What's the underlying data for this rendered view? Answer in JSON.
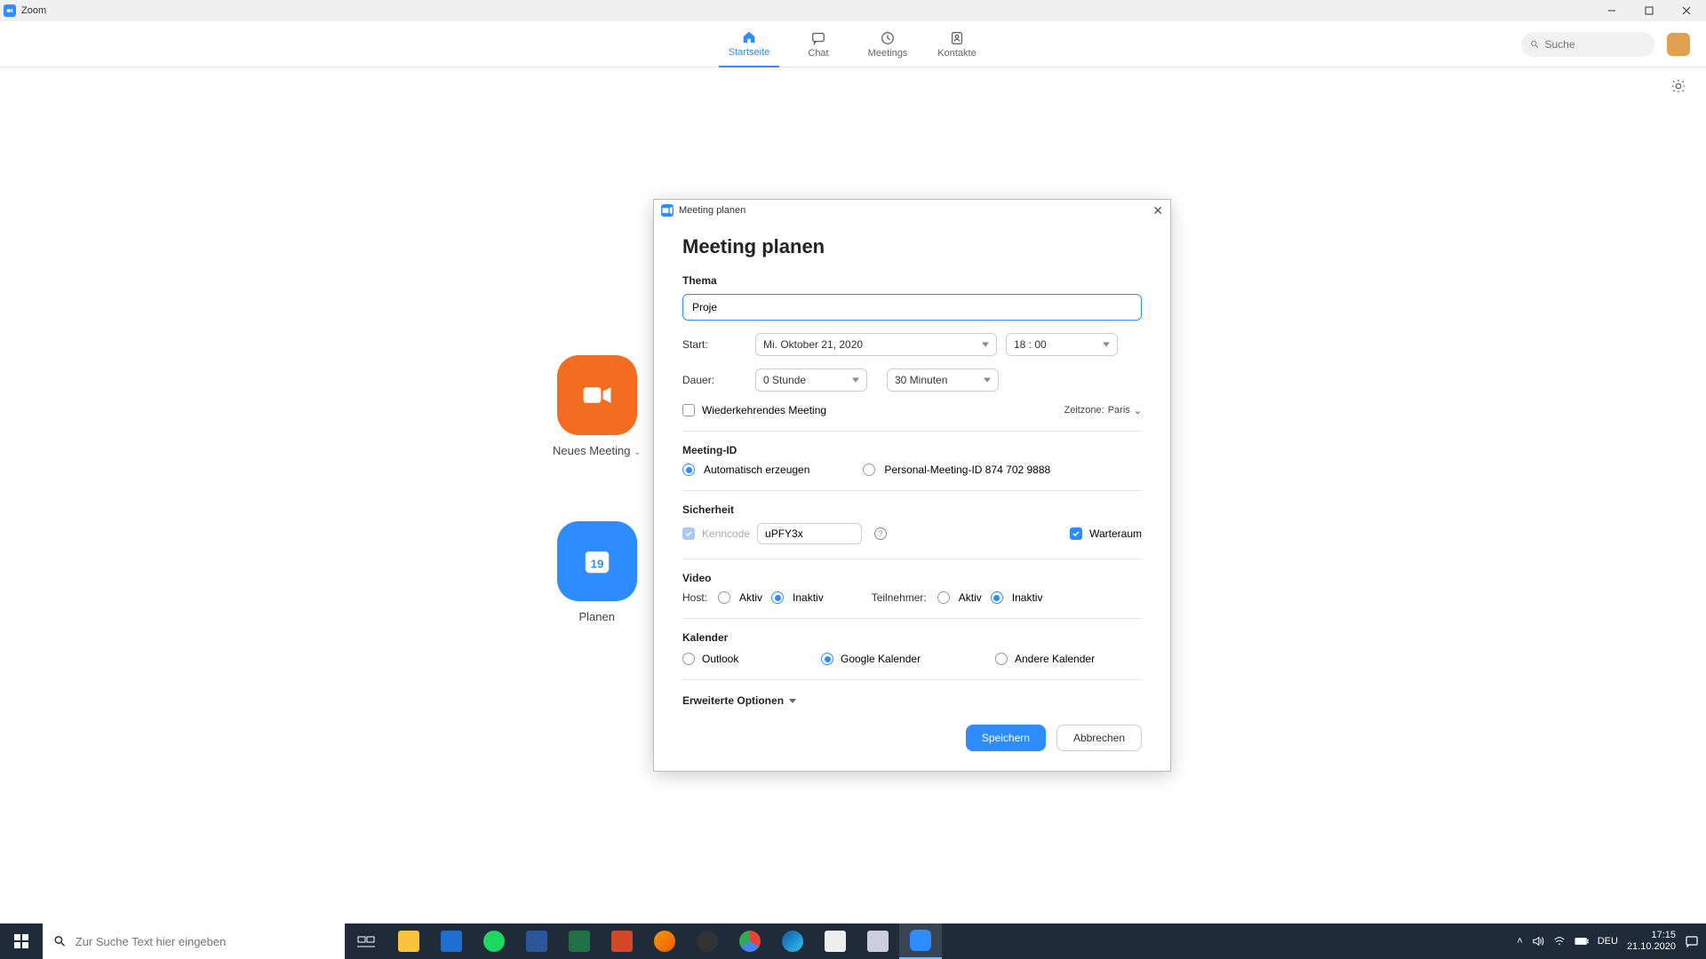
{
  "titlebar": {
    "app": "Zoom"
  },
  "nav": {
    "tabs": [
      {
        "label": "Startseite"
      },
      {
        "label": "Chat"
      },
      {
        "label": "Meetings"
      },
      {
        "label": "Kontakte"
      }
    ],
    "search_placeholder": "Suche"
  },
  "bg": {
    "new_meeting": "Neues Meeting",
    "schedule": "Planen",
    "calendar_day": "19"
  },
  "modal": {
    "window_title": "Meeting planen",
    "heading": "Meeting planen",
    "theme_label": "Thema",
    "theme_value": "Proje",
    "start_label": "Start:",
    "start_date": "Mi.  Oktober  21,  2020",
    "start_time": "18 : 00",
    "duration_label": "Dauer:",
    "duration_hours": "0 Stunde",
    "duration_minutes": "30 Minuten",
    "recurring": "Wiederkehrendes Meeting",
    "timezone_label": "Zeitzone:",
    "timezone_value": "Paris",
    "meeting_id_label": "Meeting-ID",
    "id_auto": "Automatisch erzeugen",
    "id_personal": "Personal-Meeting-ID 874 702 9888",
    "security_label": "Sicherheit",
    "passcode_label": "Kenncode",
    "passcode_value": "uPFY3x",
    "waitroom": "Warteraum",
    "video_label": "Video",
    "host_label": "Host:",
    "participant_label": "Teilnehmer:",
    "active": "Aktiv",
    "inactive": "Inaktiv",
    "calendar_label": "Kalender",
    "cal_outlook": "Outlook",
    "cal_google": "Google Kalender",
    "cal_other": "Andere Kalender",
    "advanced": "Erweiterte Optionen",
    "save": "Speichern",
    "cancel": "Abbrechen"
  },
  "taskbar": {
    "search_placeholder": "Zur Suche Text hier eingeben",
    "lang": "DEU",
    "time": "17:15",
    "date": "21.10.2020"
  }
}
